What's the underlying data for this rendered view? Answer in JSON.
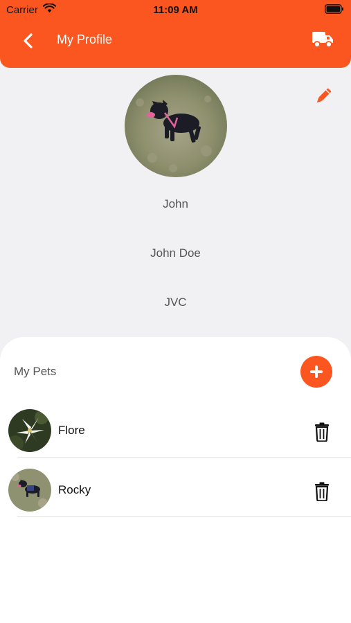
{
  "status_bar": {
    "carrier": "Carrier",
    "time": "11:09 AM"
  },
  "header": {
    "title": "My Profile",
    "back_icon": "chevron-left-icon",
    "action_icon": "truck-icon"
  },
  "profile": {
    "first_name": "John",
    "full_name": "John Doe",
    "extra": "JVC",
    "edit_icon": "pencil-icon"
  },
  "pets": {
    "heading": "My Pets",
    "add_icon": "plus-icon",
    "items": [
      {
        "name": "Flore",
        "delete_icon": "trash-icon"
      },
      {
        "name": "Rocky",
        "delete_icon": "trash-icon"
      }
    ]
  },
  "colors": {
    "accent": "#fb5620",
    "background": "#f1f1f4",
    "panel": "#ffffff"
  }
}
